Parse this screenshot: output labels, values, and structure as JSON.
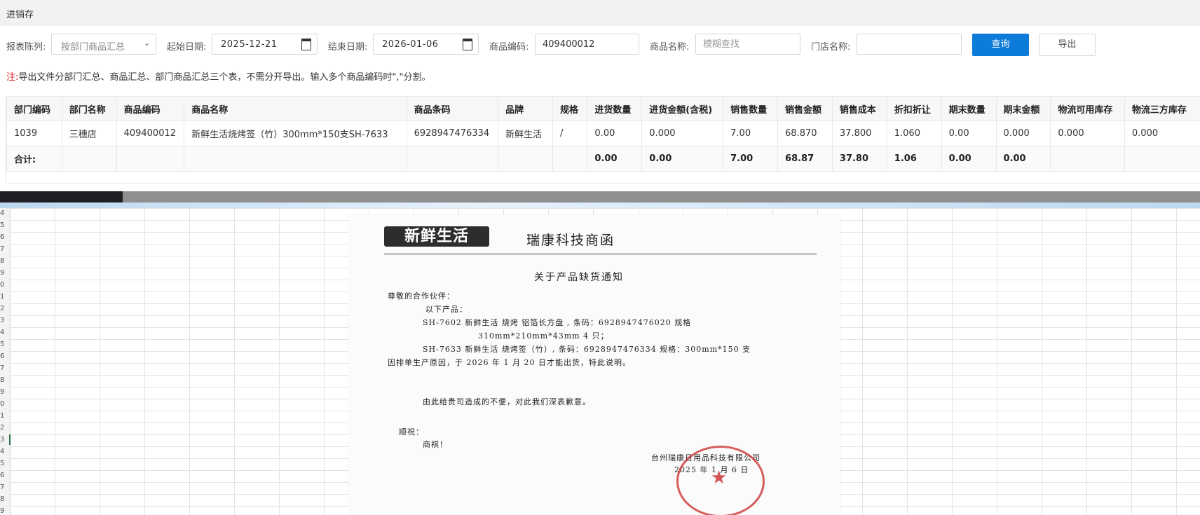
{
  "header": {
    "title": "进销存"
  },
  "filters": {
    "report_label": "报表陈列:",
    "report_value": "按部门商品汇总",
    "start_label": "起始日期:",
    "start_value": "2025-12-21",
    "end_label": "结束日期:",
    "end_value": "2026-01-06",
    "code_label": "商品编码:",
    "code_value": "409400012",
    "name_label": "商品名称:",
    "name_placeholder": "模糊查找",
    "store_label": "门店名称:",
    "store_value": "",
    "query_button": "查询",
    "export_button": "导出"
  },
  "note": {
    "prefix": "注:",
    "text": "导出文件分部门汇总、商品汇总、部门商品汇总三个表，不需分开导出。输入多个商品编码时\",\"分割。"
  },
  "table": {
    "headers": [
      "部门编码",
      "部门名称",
      "商品编码",
      "商品名称",
      "商品条码",
      "品牌",
      "规格",
      "进货数量",
      "进货金额(含税)",
      "销售数量",
      "销售金额",
      "销售成本",
      "折扣折让",
      "期末数量",
      "期末金额",
      "物流可用库存",
      "物流三方库存"
    ],
    "rows": [
      [
        "1039",
        "三穗店",
        "409400012",
        "新鲜生活烧烤签（竹）300mm*150支SH-7633",
        "6928947476334",
        "新鲜生活",
        "/",
        "0.00",
        "0.000",
        "7.00",
        "68.870",
        "37.800",
        "1.060",
        "0.00",
        "0.000",
        "0.000",
        "0.000"
      ]
    ],
    "total": [
      "合计:",
      "",
      "",
      "",
      "",
      "",
      "",
      "0.00",
      "0.00",
      "7.00",
      "68.87",
      "37.80",
      "1.06",
      "0.00",
      "0.00",
      "",
      ""
    ]
  },
  "spreadsheet": {
    "row_numbers": [
      "4",
      "5",
      "6",
      "7",
      "8",
      "9",
      "0",
      "1",
      "2",
      "3",
      "4",
      "5",
      "6",
      "7",
      "8",
      "9",
      "0",
      "1",
      "2",
      "3",
      "4",
      "5",
      "6",
      "7",
      "8",
      "9"
    ]
  },
  "letter": {
    "logo_text": "新鲜生活",
    "company": "瑞康科技商函",
    "title": "关于产品缺货通知",
    "greeting": "尊敬的合作伙伴：",
    "intro": "以下产品：",
    "item1_line1": "SH-7602 新鲜生活 烧烤 铝箔长方盘 , 条码：6928947476020 规格",
    "item1_line2": "310mm*210mm*43mm 4 只；",
    "item2_line1": "SH-7633 新鲜生活 烧烤签（竹）, 条码：6928947476334 规格：300mm*150 支",
    "item2_line2": "因排单生产原因，于 2026 年 1 月 20 日才能出货，特此说明。",
    "apology": "由此给贵司造成的不便，对此我们深表歉意。",
    "closing1": "顺祝：",
    "closing2": "商祺！",
    "signature_company": "台州瑞康日用品科技有限公司",
    "signature_date": "2025 年 1 月 6 日"
  }
}
